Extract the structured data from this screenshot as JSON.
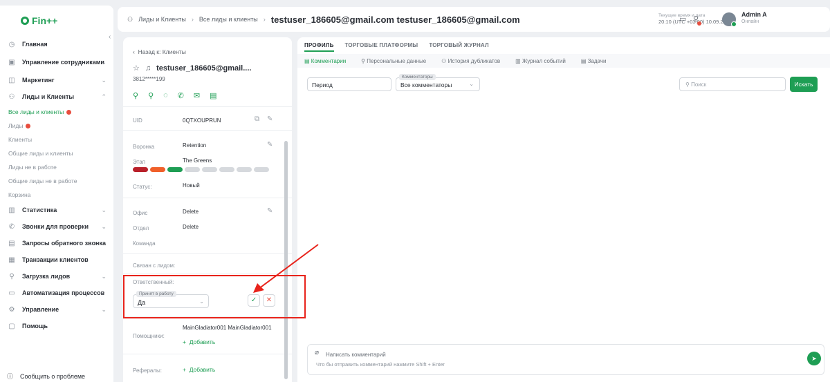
{
  "app": {
    "logo_text": "Fin++"
  },
  "sidebar": {
    "items": [
      {
        "label": "Главная",
        "icon": "clock-icon"
      },
      {
        "label": "Управление сотрудниками",
        "icon": "users-icon"
      },
      {
        "label": "Маркетинг",
        "icon": "megaphone-icon"
      },
      {
        "label": "Лиды и Клиенты",
        "icon": "people-icon"
      },
      {
        "label": "Статистика",
        "icon": "chart-icon"
      },
      {
        "label": "Звонки для проверки",
        "icon": "phone-icon"
      },
      {
        "label": "Запросы обратного звонка",
        "icon": "callback-icon"
      },
      {
        "label": "Транзакции клиентов",
        "icon": "transactions-icon"
      },
      {
        "label": "Загрузка лидов",
        "icon": "upload-icon"
      },
      {
        "label": "Автоматизация процессов",
        "icon": "automation-icon"
      },
      {
        "label": "Управление",
        "icon": "settings-icon"
      },
      {
        "label": "Помощь",
        "icon": "help-icon"
      }
    ],
    "sub_items": [
      {
        "label": "Все лиды и клиенты"
      },
      {
        "label": "Лиды"
      },
      {
        "label": "Клиенты"
      },
      {
        "label": "Общие лиды и клиенты"
      },
      {
        "label": "Лиды не в работе"
      },
      {
        "label": "Общие лиды не в работе"
      },
      {
        "label": "Корзина"
      }
    ],
    "report_label": "Сообщить о проблеме"
  },
  "topbar": {
    "breadcrumb": [
      "Лиды и Клиенты",
      "Все лиды и клиенты"
    ],
    "title": "testuser_186605@gmail.com testuser_186605@gmail.com",
    "time_label": "Текущее время и дата",
    "time_value": "20:10 (UTC +03:00) 10.09.2024",
    "user_name": "Admin A",
    "user_status": "Онлайн"
  },
  "card": {
    "back_label": "Назад к: Клиенты",
    "name": "testuser_186605@gmail....",
    "phone": "3812*****199",
    "uid_label": "UID",
    "uid_value": "0QTXOUPRUN",
    "funnel_label": "Воронка",
    "funnel_value": "Retention",
    "stage_label": "Этап",
    "stage_value": "The Greens",
    "status_label": "Статус:",
    "status_value": "Новый",
    "office_label": "Офис",
    "office_value": "Delete",
    "dept_label": "Отдел",
    "dept_value": "Delete",
    "team_label": "Команда",
    "linked_label": "Связан с лидом:",
    "owner_label": "Ответственный:",
    "accepted_label": "Принят в работу",
    "accepted_value": "Да",
    "assistants_label": "Помощники:",
    "assistants_value": "MainGladiator001 MainGladiator001",
    "add_label": "Добавить",
    "referrals_label": "Рефералы:",
    "stage_colors": [
      "#b9202a",
      "#f0602a",
      "#1e9e54",
      "#d6d9dd",
      "#d6d9dd",
      "#d6d9dd",
      "#d6d9dd",
      "#d6d9dd"
    ]
  },
  "panel": {
    "tabs": [
      "ПРОФИЛЬ",
      "ТОРГОВЫЕ ПЛАТФОРМЫ",
      "ТОРГОВЫЙ ЖУРНАЛ"
    ],
    "subtabs": [
      "Комментарии",
      "Персональные данные",
      "История дубликатов",
      "Журнал событий",
      "Задачи"
    ],
    "period_placeholder": "Период",
    "commentators_label": "Комментаторы",
    "commentators_value": "Все комментаторы",
    "search_placeholder": "Поиск",
    "search_button": "Искать",
    "comment_placeholder": "Написать комментарий",
    "comment_hint": "Что бы отправить комментарий нажмите Shift + Enter"
  },
  "colors": {
    "accent": "#1e9e54",
    "danger": "#e84d3d",
    "highlight": "#e8231b"
  }
}
